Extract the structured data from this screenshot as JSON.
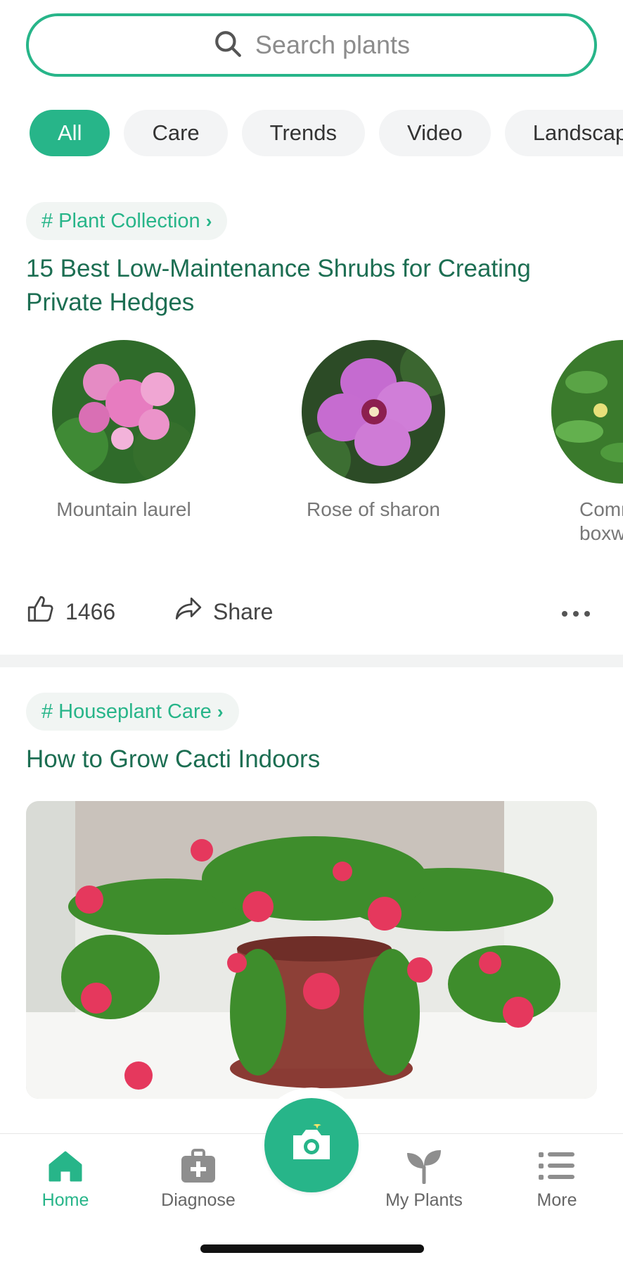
{
  "search": {
    "placeholder": "Search plants"
  },
  "chips": [
    "All",
    "Care",
    "Trends",
    "Video",
    "Landscaping"
  ],
  "post1": {
    "tag": "# Plant Collection",
    "title": "15 Best Low-Maintenance Shrubs for Creating Private Hedges",
    "plants": [
      "Mountain laurel",
      "Rose of sharon",
      "Common boxwood"
    ],
    "likes": "1466",
    "share": "Share"
  },
  "post2": {
    "tag": "# Houseplant Care",
    "title": "How to Grow Cacti Indoors"
  },
  "tabs": {
    "home": "Home",
    "diagnose": "Diagnose",
    "my_plants": "My Plants",
    "more": "More"
  },
  "colors": {
    "accent": "#27b589",
    "title": "#1c6e52"
  }
}
